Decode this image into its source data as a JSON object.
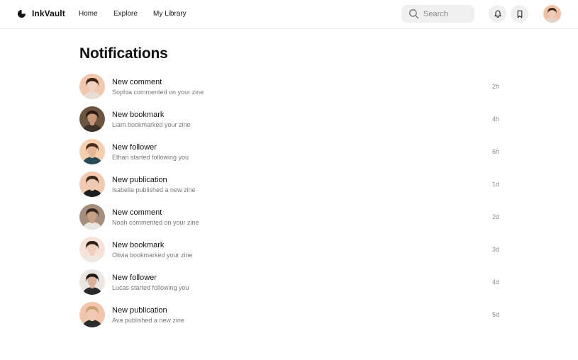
{
  "brand": {
    "name": "InkVault",
    "logo_icon": "ink-drop-logo-icon"
  },
  "nav": {
    "home": "Home",
    "explore": "Explore",
    "library": "My Library"
  },
  "search": {
    "placeholder": "Search",
    "icon": "search-icon"
  },
  "header_icons": [
    "bell-icon",
    "bookmark-icon"
  ],
  "page": {
    "title": "Notifications"
  },
  "notifications": [
    {
      "title": "New comment",
      "description": "Sophia commented on your zine",
      "time": "2h",
      "avatar": {
        "skin": "#f1d2c2",
        "hair": "#3a2418",
        "bg": "#f2c7ae",
        "shirt": "#e9dcd2"
      }
    },
    {
      "title": "New bookmark",
      "description": "Liam bookmarked your zine",
      "time": "4h",
      "avatar": {
        "skin": "#c89876",
        "hair": "#2b1c12",
        "bg": "#6b5440",
        "shirt": "#3d3026"
      }
    },
    {
      "title": "New follower",
      "description": "Ethan started following you",
      "time": "6h",
      "avatar": {
        "skin": "#e6b694",
        "hair": "#4a2e1c",
        "bg": "#f6cfae",
        "shirt": "#274a55"
      }
    },
    {
      "title": "New publication",
      "description": "Isabella published a new zine",
      "time": "1d",
      "avatar": {
        "skin": "#efc8b2",
        "hair": "#3b2418",
        "bg": "#f3c9b1",
        "shirt": "#1f1f1f"
      }
    },
    {
      "title": "New comment",
      "description": "Noah commented on your zine",
      "time": "2d",
      "avatar": {
        "skin": "#c8a084",
        "hair": "#3a2a1e",
        "bg": "#a58e7d",
        "shirt": "#e8e4e0"
      }
    },
    {
      "title": "New bookmark",
      "description": "Olivia bookmarked your zine",
      "time": "3d",
      "avatar": {
        "skin": "#f0d0bd",
        "hair": "#2f1c14",
        "bg": "#f6e2d6",
        "shirt": "#f0e8e2"
      }
    },
    {
      "title": "New follower",
      "description": "Lucas started following you",
      "time": "4d",
      "avatar": {
        "skin": "#d9b198",
        "hair": "#1e1a18",
        "bg": "#e9e6e3",
        "shirt": "#2a2a2a"
      }
    },
    {
      "title": "New publication",
      "description": "Ava published a new zine",
      "time": "5d",
      "avatar": {
        "skin": "#efcbb3",
        "hair": "#c9a372",
        "bg": "#f2c6ad",
        "shirt": "#2b2b2b"
      }
    }
  ],
  "profile": {
    "avatar": {
      "skin": "#f0cdb8",
      "hair": "#3a2418",
      "bg": "#f2c1a8",
      "shirt": "#e2d3c8"
    }
  }
}
